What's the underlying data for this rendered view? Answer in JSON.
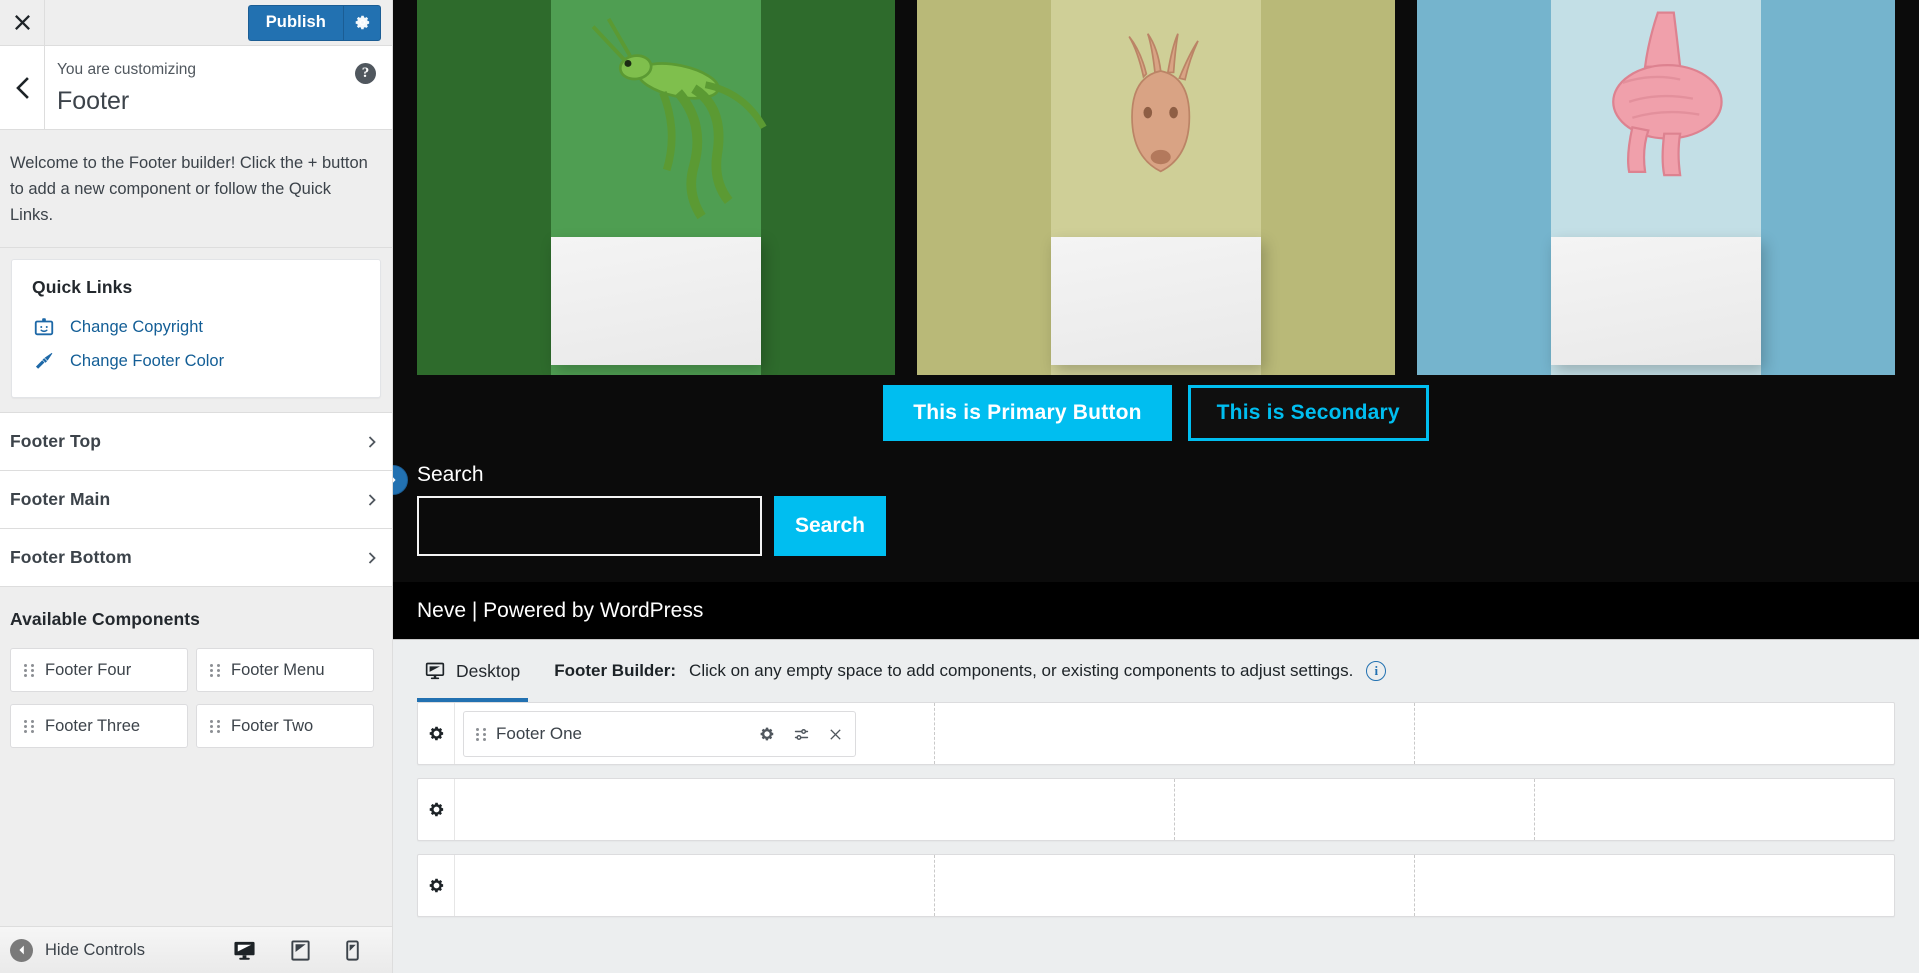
{
  "sidebar": {
    "close_label": "Close",
    "publish_label": "Publish",
    "header": {
      "eyebrow": "You are customizing",
      "title": "Footer",
      "help_label": "?"
    },
    "welcome_text": "Welcome to the Footer builder! Click the + button to add a new component or follow the Quick Links.",
    "quick_links": {
      "title": "Quick Links",
      "items": [
        {
          "label": "Change Copyright",
          "icon": "id-badge-icon"
        },
        {
          "label": "Change Footer Color",
          "icon": "paintbrush-icon"
        }
      ]
    },
    "sections": [
      {
        "label": "Footer Top"
      },
      {
        "label": "Footer Main"
      },
      {
        "label": "Footer Bottom"
      }
    ],
    "available_components": {
      "title": "Available Components",
      "items": [
        {
          "label": "Footer Four"
        },
        {
          "label": "Footer Menu"
        },
        {
          "label": "Footer Three"
        },
        {
          "label": "Footer Two"
        }
      ]
    },
    "footer": {
      "hide_controls_label": "Hide Controls",
      "devices": [
        {
          "name": "desktop",
          "active": true
        },
        {
          "name": "tablet",
          "active": false
        },
        {
          "name": "mobile",
          "active": false
        }
      ]
    }
  },
  "preview": {
    "cards": [
      {
        "name": "grasshopper-card",
        "bg": "#2e6b2c",
        "sheet": "#4f9e52",
        "animal": "grasshopper"
      },
      {
        "name": "antelope-card",
        "bg": "#b9b978",
        "sheet": "#cfcf97",
        "animal": "antelope"
      },
      {
        "name": "flamingo-card",
        "bg": "#75b4cd",
        "sheet": "#c3dfe6",
        "animal": "flamingo"
      }
    ],
    "buttons": {
      "primary_label": "This is Primary Button",
      "secondary_label": "This is Secondary",
      "primary_bg": "#00BEF0",
      "secondary_border": "#00BEF0",
      "secondary_text": "#00BEF0"
    },
    "search": {
      "label": "Search",
      "value": "",
      "placeholder": "",
      "button_label": "Search",
      "button_bg": "#00BEF0"
    },
    "credit": "Neve | Powered by WordPress"
  },
  "builder": {
    "device_tab": "Desktop",
    "hint_strong": "Footer Builder:",
    "hint_text": "Click on any empty space to add components, or existing components to adjust settings.",
    "info_label": "i",
    "accent": "#2271b1",
    "rows": [
      {
        "name": "footer-top-row",
        "columns": [
          {
            "flex": 1,
            "component": {
              "label": "Footer One"
            }
          },
          {
            "flex": 1,
            "component": null
          },
          {
            "flex": 1,
            "component": null
          }
        ]
      },
      {
        "name": "footer-main-row",
        "columns": [
          {
            "flex": 1.5,
            "component": null
          },
          {
            "flex": 0.75,
            "component": null
          },
          {
            "flex": 0.75,
            "component": null
          }
        ]
      },
      {
        "name": "footer-bottom-row",
        "columns": [
          {
            "flex": 1,
            "component": null
          },
          {
            "flex": 1,
            "component": null
          },
          {
            "flex": 1,
            "component": null
          }
        ]
      }
    ],
    "chip_actions": [
      {
        "name": "gear-icon"
      },
      {
        "name": "sliders-icon"
      },
      {
        "name": "close-icon"
      }
    ]
  }
}
